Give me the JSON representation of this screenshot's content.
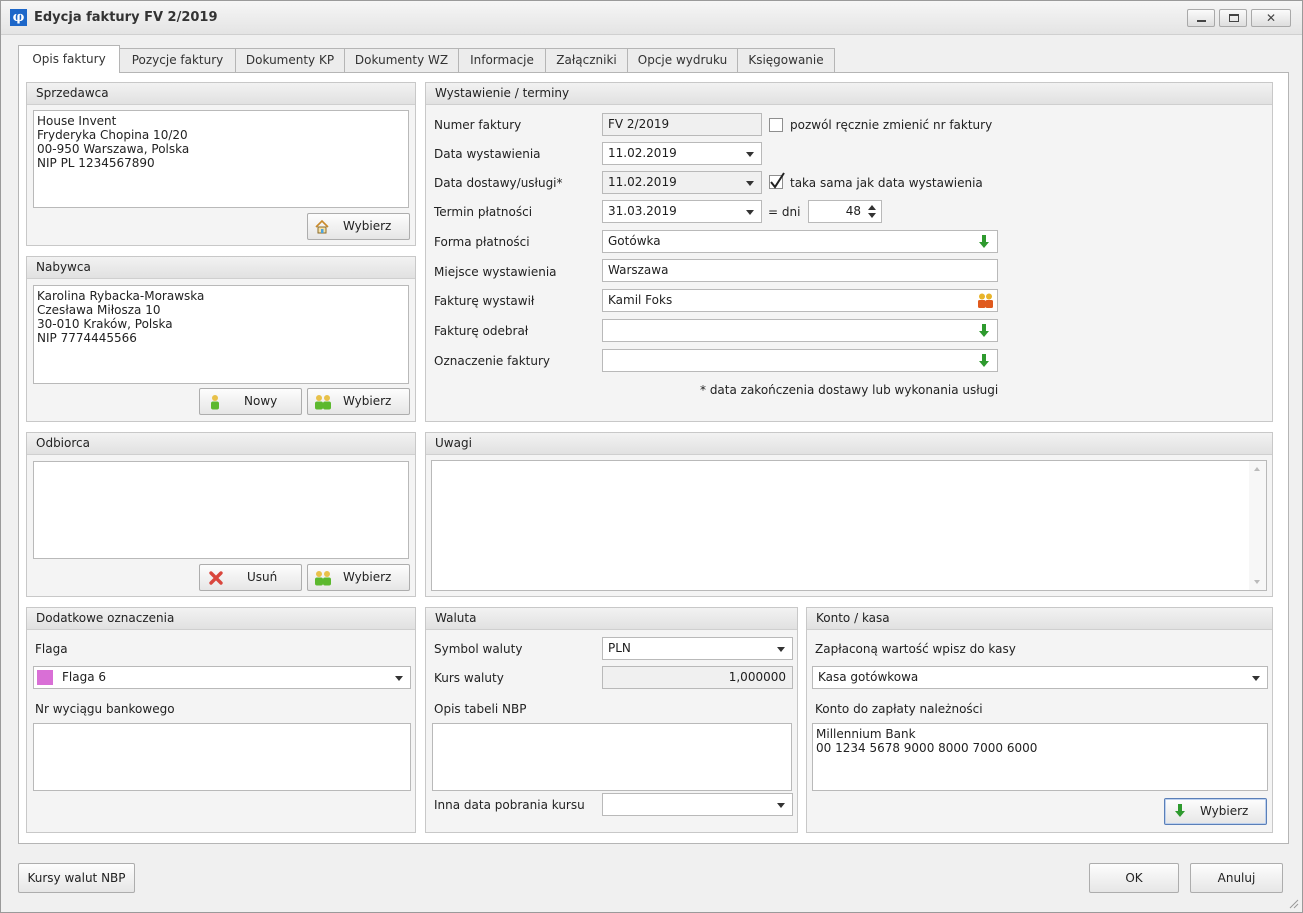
{
  "window": {
    "title": "Edycja faktury FV 2/2019",
    "icon_char": "φ"
  },
  "tabs": [
    "Opis faktury",
    "Pozycje faktury",
    "Dokumenty KP",
    "Dokumenty WZ",
    "Informacje",
    "Załączniki",
    "Opcje wydruku",
    "Księgowanie"
  ],
  "sprzedawca": {
    "title": "Sprzedawca",
    "text": "House Invent\nFryderyka Chopina 10/20\n00-950 Warszawa, Polska\nNIP PL 1234567890",
    "button": "Wybierz"
  },
  "nabywca": {
    "title": "Nabywca",
    "text": "Karolina Rybacka-Morawska\nCzesława Miłosza 10\n30-010 Kraków, Polska\nNIP 7774445566",
    "new_button": "Nowy",
    "choose_button": "Wybierz"
  },
  "odbiorca": {
    "title": "Odbiorca",
    "text": "",
    "remove_button": "Usuń",
    "choose_button": "Wybierz"
  },
  "wystawienie": {
    "title": "Wystawienie / terminy",
    "numer_label": "Numer faktury",
    "numer_value": "FV 2/2019",
    "manual_change_label": "pozwól ręcznie zmienić nr faktury",
    "manual_change_checked": false,
    "data_wyst_label": "Data wystawienia",
    "data_wyst_value": "11.02.2019",
    "data_dost_label": "Data dostawy/usługi*",
    "data_dost_value": "11.02.2019",
    "same_date_label": "taka sama jak data wystawienia",
    "same_date_checked": true,
    "termin_label": "Termin płatności",
    "termin_value": "31.03.2019",
    "dni_label": "= dni",
    "dni_value": "48",
    "forma_label": "Forma płatności",
    "forma_value": "Gotówka",
    "miejsce_label": "Miejsce wystawienia",
    "miejsce_value": "Warszawa",
    "wystawil_label": "Fakturę wystawił",
    "wystawil_value": "Kamil Foks",
    "odebral_label": "Fakturę odebrał",
    "odebral_value": "",
    "oznaczenie_label": "Oznaczenie faktury",
    "oznaczenie_value": "",
    "footnote": "* data zakończenia dostawy lub wykonania usługi"
  },
  "uwagi": {
    "title": "Uwagi",
    "text": ""
  },
  "dodatkowe": {
    "title": "Dodatkowe oznaczenia",
    "flaga_label": "Flaga",
    "flaga_value": "Flaga 6",
    "flaga_color": "#d96fd6",
    "wyciag_label": "Nr wyciągu bankowego",
    "wyciag_value": ""
  },
  "waluta": {
    "title": "Waluta",
    "symbol_label": "Symbol waluty",
    "symbol_value": "PLN",
    "kurs_label": "Kurs waluty",
    "kurs_value": "1,000000",
    "opis_label": "Opis tabeli NBP",
    "opis_value": "",
    "inna_data_label": "Inna data pobrania kursu",
    "inna_data_value": ""
  },
  "konto": {
    "title": "Konto / kasa",
    "kasa_label": "Zapłaconą wartość wpisz do kasy",
    "kasa_value": "Kasa gotówkowa",
    "konto_label": "Konto do zapłaty należności",
    "konto_text": "Millennium Bank\n00 1234 5678 9000 8000 7000 6000",
    "button": "Wybierz"
  },
  "footer": {
    "kursy_button": "Kursy walut NBP",
    "ok_button": "OK",
    "cancel_button": "Anuluj"
  },
  "colors": {
    "green_arrow": "#2e9a2e",
    "accent": "#1d67c9"
  }
}
